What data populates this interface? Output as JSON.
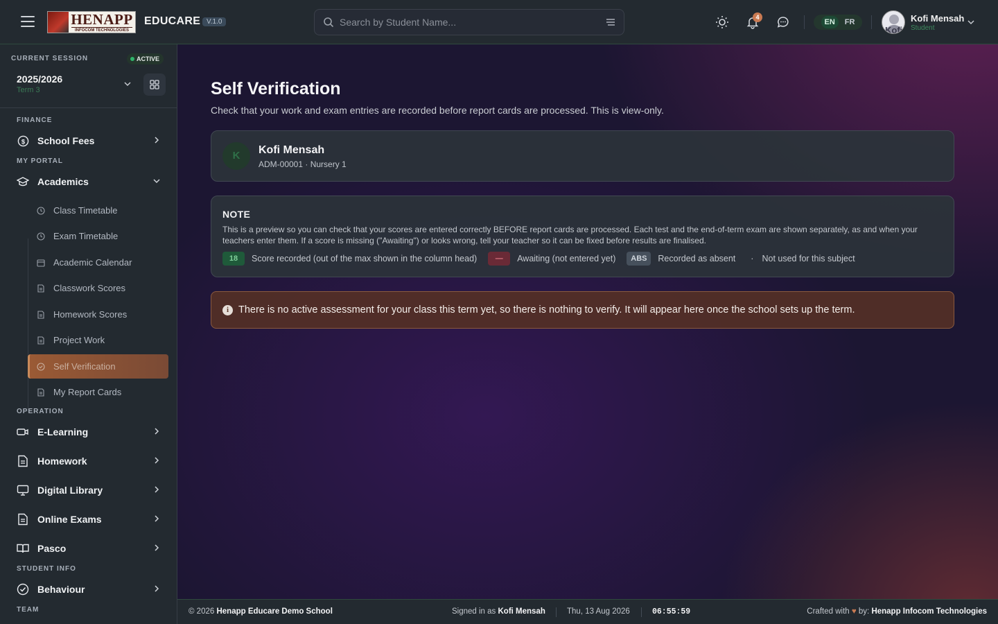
{
  "header": {
    "logo_big": "HENAPP",
    "logo_small": "INFOCOM TECHNOLOGIES",
    "app_name": "EDUCARE",
    "version": "V.1.0",
    "search_placeholder": "Search by Student Name...",
    "notification_count": "4",
    "languages": [
      "EN",
      "FR"
    ],
    "user": {
      "name": "Kofi Mensah",
      "role": "Student",
      "avatar_text": "Kofi"
    }
  },
  "session": {
    "label": "CURRENT SESSION",
    "status": "ACTIVE",
    "year": "2025/2026",
    "term": "Term 3"
  },
  "sidebar": {
    "sections": {
      "finance": "FINANCE",
      "my_portal": "MY PORTAL",
      "operation": "OPERATION",
      "student_info": "STUDENT INFO",
      "team": "TEAM"
    },
    "items": {
      "school_fees": "School Fees",
      "academics": "Academics",
      "e_learning": "E-Learning",
      "homework": "Homework",
      "digital_library": "Digital Library",
      "online_exams": "Online Exams",
      "pasco": "Pasco",
      "behaviour": "Behaviour"
    },
    "academics_sub": [
      "Class Timetable",
      "Exam Timetable",
      "Academic Calendar",
      "Classwork Scores",
      "Homework Scores",
      "Project Work",
      "Self Verification",
      "My Report Cards"
    ]
  },
  "main": {
    "title": "Self Verification",
    "description": "Check that your work and exam entries are recorded before report cards are processed. This is view-only.",
    "student": {
      "initial": "K",
      "name": "Kofi Mensah",
      "meta": "ADM-00001 · Nursery 1"
    },
    "note": {
      "heading": "NOTE",
      "text": "This is a preview so you can check that your scores are entered correctly BEFORE report cards are processed. Each test and the end-of-term exam are shown separately, as and when your teachers enter them. If a score is missing (\"Awaiting\") or looks wrong, tell your teacher so it can be fixed before results are finalised.",
      "legend": [
        {
          "chip": "18",
          "label": "Score recorded (out of the max shown in the column head)"
        },
        {
          "chip": "—",
          "label": "Awaiting (not entered yet)"
        },
        {
          "chip": "ABS",
          "label": "Recorded as absent"
        },
        {
          "chip": "·",
          "label": "Not used for this subject"
        }
      ]
    },
    "alert": "There is no active assessment for your class this term yet, so there is nothing to verify. It will appear here once the school sets up the term."
  },
  "footer": {
    "copyright": "© 2026",
    "school": "Henapp Educare Demo School",
    "signed_in_label": "Signed in as",
    "signed_in_user": "Kofi Mensah",
    "date": "Thu, 13 Aug 2026",
    "time": "06:55:59",
    "crafted_label": "Crafted with",
    "crafted_by": "by:",
    "company": "Henapp Infocom Technologies"
  },
  "colors": {
    "accent_green": "#2fb36a",
    "active_menu": "#9a5a35",
    "alert_border": "#8a5a3e",
    "heart": "#c97a52"
  }
}
